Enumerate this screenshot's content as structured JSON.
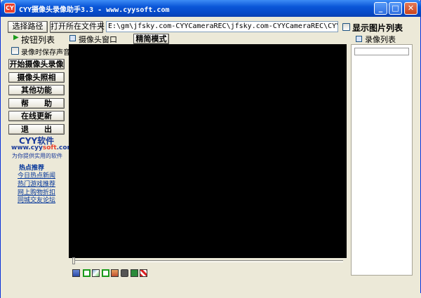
{
  "window": {
    "title": "CYY摄像头录像助手3.3 - www.cyysoft.com",
    "icon_text": "CY"
  },
  "toolbar": {
    "select_path": "选择路径",
    "open_folder": "打开所在文件夹",
    "path_value": "E:\\gm\\jfsky.com-CYYCameraREC\\jfsky.com-CYYCameraREC\\CYYCamer",
    "show_image_list": "显示图片列表"
  },
  "left": {
    "button_list": "按钮列表",
    "save_audio": "录像时保存声音",
    "start_record": "开始摄像头录像",
    "snapshot": "摄像头照相",
    "other": "其他功能",
    "help": "帮　　助",
    "update": "在线更新",
    "exit": "退　　出"
  },
  "brand": {
    "name": "CYY软件",
    "url_prefix": "www.cyy",
    "url_mid": "soft",
    "url_suffix": ".com",
    "tagline": "为你提供实用的软件"
  },
  "hot": {
    "title": "热点推荐",
    "links": [
      "今日热点新闻",
      "热门游戏推荐",
      "网上购物折扣",
      "同城交友论坛"
    ]
  },
  "camera": {
    "window_label": "摄像头窗口",
    "simple_mode": "精简模式"
  },
  "right": {
    "record_list": "录像列表"
  },
  "colors": {
    "title_blue": "#0a56d8",
    "video_bg": "#000000",
    "brand_blue": "#1a3a9a",
    "link_blue": "#003399"
  },
  "icons": [
    "save-icon",
    "green-square-icon",
    "picture-icon",
    "double-square-icon",
    "image-icon",
    "camera-icon",
    "monitor-icon",
    "grid-icon"
  ]
}
